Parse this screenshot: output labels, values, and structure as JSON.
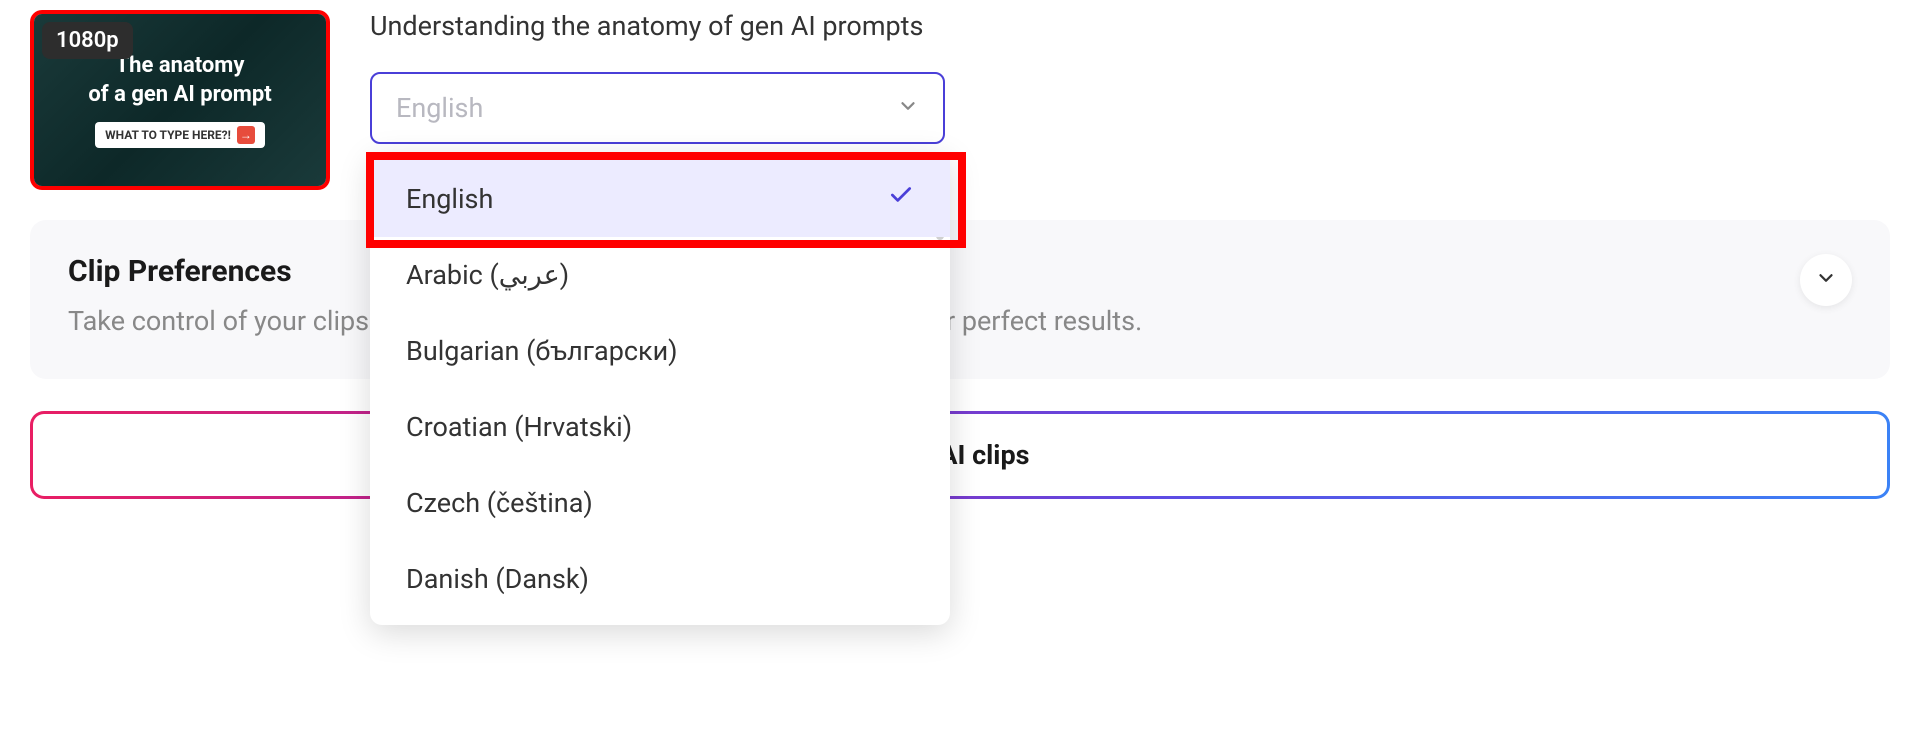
{
  "thumbnail": {
    "badge": "1080p",
    "title_line1": "The anatomy",
    "title_line2": "of a gen AI prompt",
    "button_text": "WHAT TO TYPE HERE?!"
  },
  "video": {
    "title": "Understanding the anatomy of gen AI prompts"
  },
  "language_select": {
    "placeholder": "English",
    "options": [
      {
        "label": "English",
        "selected": true
      },
      {
        "label": "Arabic (عربي)",
        "selected": false
      },
      {
        "label": "Bulgarian (български)",
        "selected": false
      },
      {
        "label": "Croatian (Hrvatski)",
        "selected": false
      },
      {
        "label": "Czech (čeština)",
        "selected": false
      },
      {
        "label": "Danish (Dansk)",
        "selected": false
      }
    ]
  },
  "preferences": {
    "title": "Clip Preferences",
    "description": "Take control of your clips by adjusting length, ratio, style, and keywords for perfect results."
  },
  "cta": {
    "label": "Get AI clips"
  }
}
